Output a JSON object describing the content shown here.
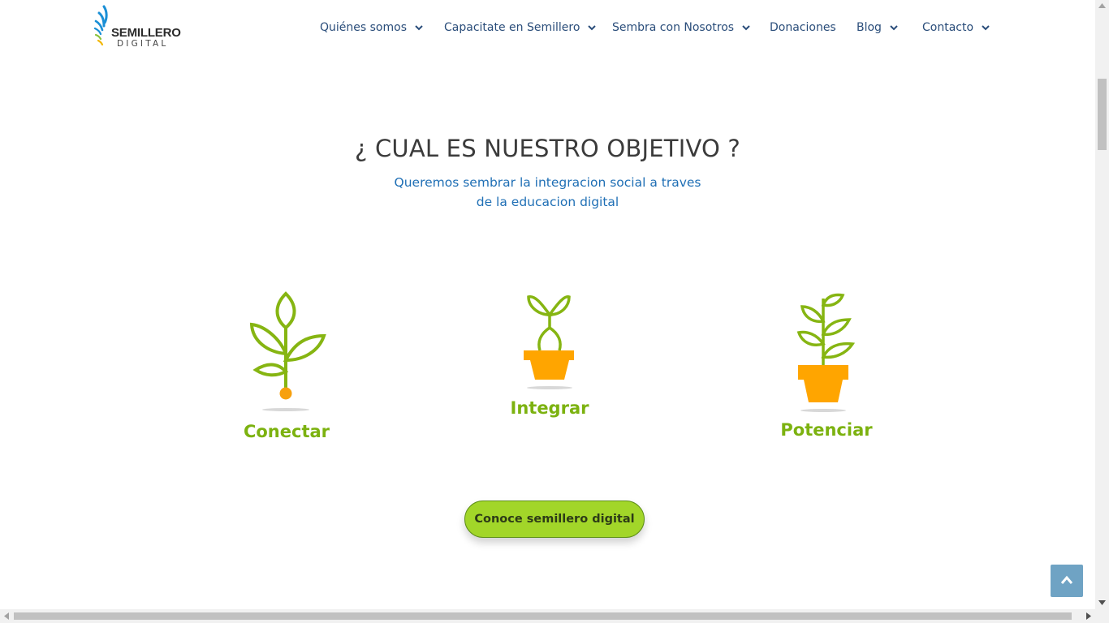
{
  "logo": {
    "word": "SEMILLERO",
    "sub": "DIGITAL"
  },
  "nav": [
    {
      "label": "Quiénes somos",
      "dropdown": true
    },
    {
      "label": "Capacitate en Semillero",
      "dropdown": true
    },
    {
      "label": "Sembra con Nosotros",
      "dropdown": true
    },
    {
      "label": "Donaciones",
      "dropdown": false
    },
    {
      "label": "Blog",
      "dropdown": true
    },
    {
      "label": "Contacto",
      "dropdown": true
    }
  ],
  "section": {
    "title": "¿ CUAL ES NUESTRO OBJETIVO ?",
    "subtitle_line1": "Queremos sembrar la integracion social a traves",
    "subtitle_line2": "de la educacion digital"
  },
  "features": [
    {
      "label": "Conectar",
      "icon": "sprout-seed-icon"
    },
    {
      "label": "Integrar",
      "icon": "sprout-pot-icon"
    },
    {
      "label": "Potenciar",
      "icon": "plant-pot-icon"
    }
  ],
  "cta": {
    "label": "Conoce semillero digital"
  },
  "colors": {
    "accent_green": "#7cb210",
    "button_green": "#a2d629",
    "pot_orange": "#ffa500",
    "nav_blue": "#2a4d7a",
    "subtitle_blue": "#1f6fb5"
  }
}
